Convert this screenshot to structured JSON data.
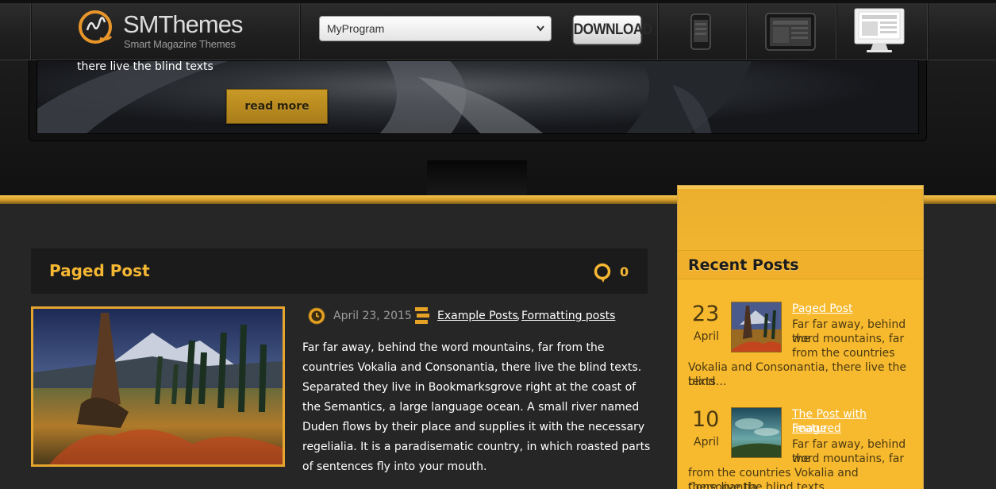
{
  "header": {
    "logo_name": "SMThemes",
    "logo_tagline": "Smart Magazine Themes",
    "program_select_value": "MyProgram",
    "download_label": "DOWNLOAD",
    "devices": [
      "phone-preview-icon",
      "tablet-preview-icon",
      "desktop-preview-icon"
    ]
  },
  "hero": {
    "caption": "there live the blind texts",
    "read_more": "read more"
  },
  "post": {
    "title": "Paged Post",
    "comment_count": "0",
    "date": "April 23, 2015",
    "categories": [
      "Example Posts",
      "Formatting posts"
    ],
    "category_separator": ",",
    "body": "Far far away, behind the word mountains, far from the countries Vokalia and Consonantia, there live the blind texts. Separated they live in Bookmarksgrove right at the coast of the Semantics, a large language ocean. A small river named Duden flows by their place and supplies it with the necessary regelialia. It is a paradisematic country, in which roasted parts of sentences fly into your mouth."
  },
  "sidebar": {
    "widget_title": "Recent Posts",
    "recent_posts": [
      {
        "day": "23",
        "month": "April",
        "title": "Paged Post",
        "excerpt_lines": [
          "Far far away, behind the",
          "word mountains, far",
          "from the countries",
          "Vokalia and Consonantia, there live the blind",
          "texts..."
        ]
      },
      {
        "day": "10",
        "month": "April",
        "title_lines": [
          "The Post with Featured",
          "Image"
        ],
        "excerpt_lines": [
          "Far far away, behind the",
          "word mountains, far",
          "from the countries Vokalia and Consonantia,",
          "there live the blind texts..."
        ]
      }
    ]
  },
  "colors": {
    "accent_gold": "#f6b733",
    "sidebar_bg": "#f7b92e",
    "dark_bg": "#262626",
    "header_bg": "#1b1b1b"
  }
}
